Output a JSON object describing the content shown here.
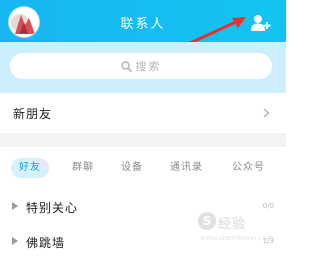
{
  "header": {
    "title": "联系人",
    "avatar_icon": "user-avatar",
    "add_contact_icon": "add-contact-icon",
    "accent_color": "#17b6f2"
  },
  "search": {
    "placeholder": "搜索",
    "icon": "search-icon"
  },
  "new_friends": {
    "label": "新朋友",
    "icon": "chevron-right-icon"
  },
  "tabs": [
    {
      "label": "好友",
      "active": true
    },
    {
      "label": "群聊",
      "active": false
    },
    {
      "label": "设备",
      "active": false
    },
    {
      "label": "通讯录",
      "active": false
    },
    {
      "label": "公众号",
      "active": false
    }
  ],
  "groups": [
    {
      "name": "特别关心",
      "count": "0/0"
    },
    {
      "name": "佛跳墙",
      "count": "1/3"
    }
  ],
  "watermark": {
    "text": "经验",
    "url": "www.shenduwin.com"
  }
}
